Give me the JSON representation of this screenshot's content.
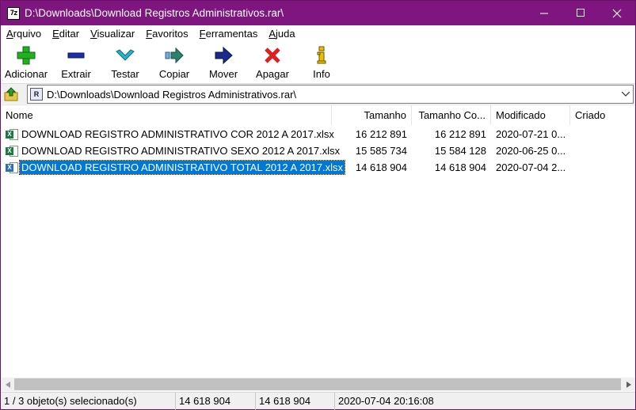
{
  "window": {
    "app_icon_text": "7z",
    "title": "D:\\Downloads\\Download Registros Administrativos.rar\\"
  },
  "menu": [
    {
      "label": "Arquivo",
      "key": "A",
      "rest": "rquivo"
    },
    {
      "label": "Editar",
      "key": "E",
      "rest": "ditar"
    },
    {
      "label": "Visualizar",
      "key": "V",
      "rest": "isualizar"
    },
    {
      "label": "Favoritos",
      "key": "F",
      "rest": "avoritos"
    },
    {
      "label": "Ferramentas",
      "key": "F",
      "rest": "erramentas"
    },
    {
      "label": "Ajuda",
      "key": "A",
      "rest": "juda"
    }
  ],
  "toolbar": {
    "add_label": "Adicionar",
    "extract_label": "Extrair",
    "test_label": "Testar",
    "copy_label": "Copiar",
    "move_label": "Mover",
    "delete_label": "Apagar",
    "info_label": "Info",
    "icons": [
      "plus-icon",
      "minus-icon",
      "check-icon",
      "copy-arrow-icon",
      "move-arrow-icon",
      "delete-x-icon",
      "info-icon"
    ],
    "colors": {
      "add": "#22b022",
      "extract": "#1a2fa8",
      "test": "#2ab0c8",
      "copy": "#2f7f6f",
      "move": "#1a2a8a",
      "delete": "#e02020",
      "info": "#e8c000"
    }
  },
  "address": {
    "icon_text": "R",
    "path": "D:\\Downloads\\Download Registros Administrativos.rar\\"
  },
  "columns": {
    "name": "Nome",
    "size": "Tamanho",
    "packed": "Tamanho Co...",
    "modified": "Modificado",
    "created": "Criado"
  },
  "files": [
    {
      "name": "DOWNLOAD REGISTRO ADMINISTRATIVO COR 2012 A 2017.xlsx",
      "size": "16 212 891",
      "packed": "16 212 891",
      "modified": "2020-07-21 0...",
      "created": "",
      "selected": false
    },
    {
      "name": "DOWNLOAD REGISTRO ADMINISTRATIVO SEXO 2012 A 2017.xlsx",
      "size": "15 585 734",
      "packed": "15 584 128",
      "modified": "2020-06-25 0...",
      "created": "",
      "selected": false
    },
    {
      "name": "DOWNLOAD REGISTRO ADMINISTRATIVO TOTAL 2012 A 2017.xlsx",
      "size": "14 618 904",
      "packed": "14 618 904",
      "modified": "2020-07-04 2...",
      "created": "",
      "selected": true
    }
  ],
  "file_icon_text": "X",
  "status": {
    "selection": "1 / 3 objeto(s) selecionado(s)",
    "size": "14 618 904",
    "packed": "14 618 904",
    "modified": "2020-07-04 20:16:08"
  },
  "colors": {
    "titlebar": "#7f157f",
    "selection": "#0078d7"
  }
}
